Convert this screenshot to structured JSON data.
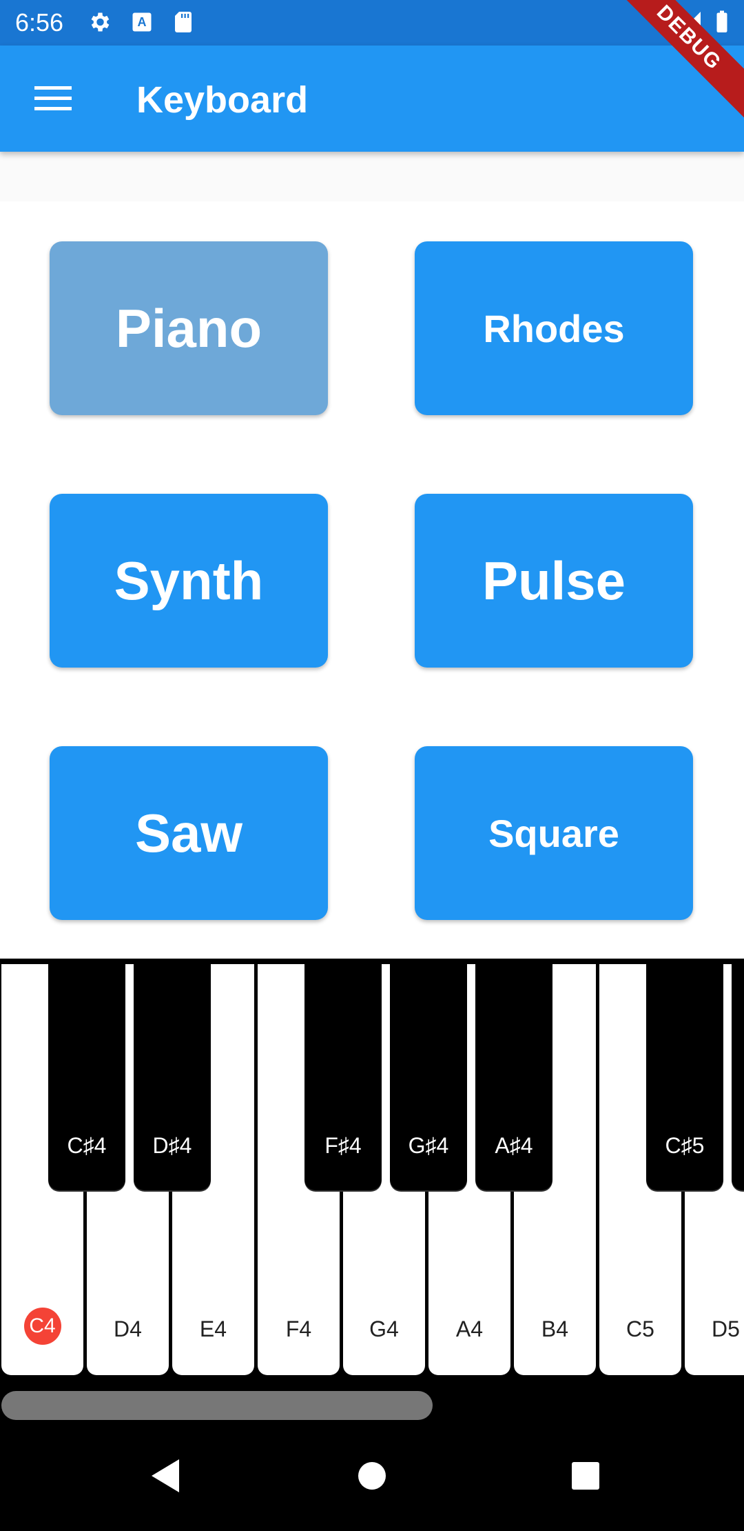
{
  "status_bar": {
    "time": "6:56",
    "icons": [
      "gear-icon",
      "keyboard-a-icon",
      "sd-card-icon",
      "wifi-icon",
      "signal-icon",
      "battery-icon"
    ],
    "color": "#1976d2"
  },
  "app_bar": {
    "title": "Keyboard",
    "menu_icon": "hamburger-menu-icon",
    "color": "#2196f3"
  },
  "debug_banner": "DEBUG",
  "instruments": [
    {
      "label": "Piano",
      "selected": true
    },
    {
      "label": "Rhodes",
      "selected": false
    },
    {
      "label": "Synth",
      "selected": false
    },
    {
      "label": "Pulse",
      "selected": false
    },
    {
      "label": "Saw",
      "selected": false
    },
    {
      "label": "Square",
      "selected": false
    }
  ],
  "keyboard": {
    "white_keys": [
      "C4",
      "D4",
      "E4",
      "F4",
      "G4",
      "A4",
      "B4",
      "C5",
      "D5"
    ],
    "black_keys": [
      "C♯4",
      "D♯4",
      "F♯4",
      "G♯4",
      "A♯4",
      "C♯5",
      ""
    ],
    "active_key": "C4",
    "active_color": "#f44336"
  },
  "nav_bar": {
    "buttons": [
      "back-icon",
      "home-icon",
      "recents-icon"
    ]
  }
}
